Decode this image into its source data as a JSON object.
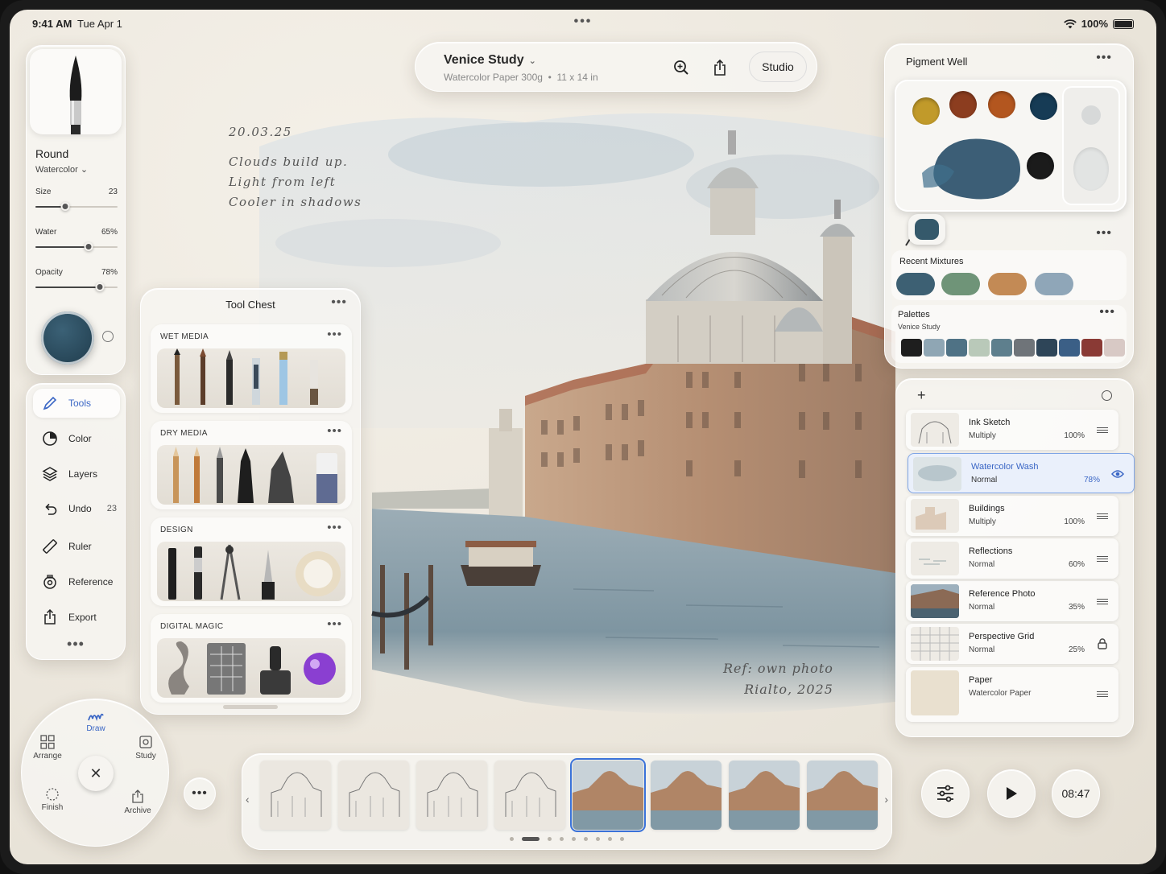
{
  "status": {
    "time": "9:41 AM",
    "date": "Tue Apr 1",
    "battery": "100%"
  },
  "document": {
    "title": "Venice Study",
    "paper": "Watercolor Paper 300g",
    "size": "11 x 14 in",
    "studio_label": "Studio"
  },
  "notes": {
    "date": "20.03.25",
    "lines": [
      "Clouds build up.",
      "Light from left",
      "Cooler in shadows"
    ],
    "ref_line1": "Ref: own photo",
    "ref_line2": "Rialto, 2025"
  },
  "brush": {
    "name": "Round",
    "type": "Watercolor",
    "size_label": "Size",
    "size_value": "23",
    "size_fraction": 0.36,
    "water_label": "Water",
    "water_value": "65%",
    "water_fraction": 0.65,
    "opacity_label": "Opacity",
    "opacity_value": "78%",
    "opacity_fraction": 0.78,
    "color": "#2e5266"
  },
  "nav": [
    {
      "label": "Tools",
      "icon": "pencil-icon",
      "active": true
    },
    {
      "label": "Color",
      "icon": "color-wheel-icon"
    },
    {
      "label": "Layers",
      "icon": "layers-icon"
    },
    {
      "label": "Undo",
      "icon": "undo-icon",
      "badge": "23"
    },
    {
      "label": "Ruler",
      "icon": "ruler-icon"
    },
    {
      "label": "Reference",
      "icon": "reference-icon"
    },
    {
      "label": "Export",
      "icon": "export-icon"
    }
  ],
  "tool_chest": {
    "title": "Tool Chest",
    "sections": [
      "WET MEDIA",
      "DRY MEDIA",
      "DESIGN",
      "DIGITAL MAGIC"
    ]
  },
  "pigment_well": {
    "title": "Pigment Well",
    "recent_label": "Recent Mixtures",
    "recent_colors": [
      "#3d6073",
      "#6f9478",
      "#c38a55",
      "#8fa6b8"
    ],
    "palettes_label": "Palettes",
    "palette_name": "Venice Study",
    "palette_colors": [
      "#1e1e1e",
      "#8fa6b4",
      "#4f7285",
      "#b9c9b9",
      "#5e7f8d",
      "#6f7479",
      "#2e4558",
      "#3b5f86",
      "#8a3a35",
      "#d8c9c5"
    ]
  },
  "layers": [
    {
      "name": "Ink Sketch",
      "mode": "Multiply",
      "opacity": "100%",
      "action": "reorder-icon"
    },
    {
      "name": "Watercolor Wash",
      "mode": "Normal",
      "opacity": "78%",
      "action": "eye-icon",
      "selected": true
    },
    {
      "name": "Buildings",
      "mode": "Multiply",
      "opacity": "100%",
      "action": "reorder-icon"
    },
    {
      "name": "Reflections",
      "mode": "Normal",
      "opacity": "60%",
      "action": "reorder-icon"
    },
    {
      "name": "Reference Photo",
      "mode": "Normal",
      "opacity": "35%",
      "action": "reorder-icon"
    },
    {
      "name": "Perspective Grid",
      "mode": "Normal",
      "opacity": "25%",
      "action": "lock-icon"
    },
    {
      "name": "Paper",
      "mode": "Watercolor Paper",
      "opacity": "",
      "action": "reorder-icon"
    }
  ],
  "radial": {
    "draw": "Draw",
    "arrange": "Arrange",
    "study": "Study",
    "finish": "Finish",
    "archive": "Archive"
  },
  "timeline": {
    "selected_index": 4,
    "frame_count": 8,
    "page_count": 9,
    "active_page": 1
  },
  "playback": {
    "time": "08:47"
  },
  "colors": {
    "accent": "#3a66c5",
    "selection": "#3a72d9"
  }
}
